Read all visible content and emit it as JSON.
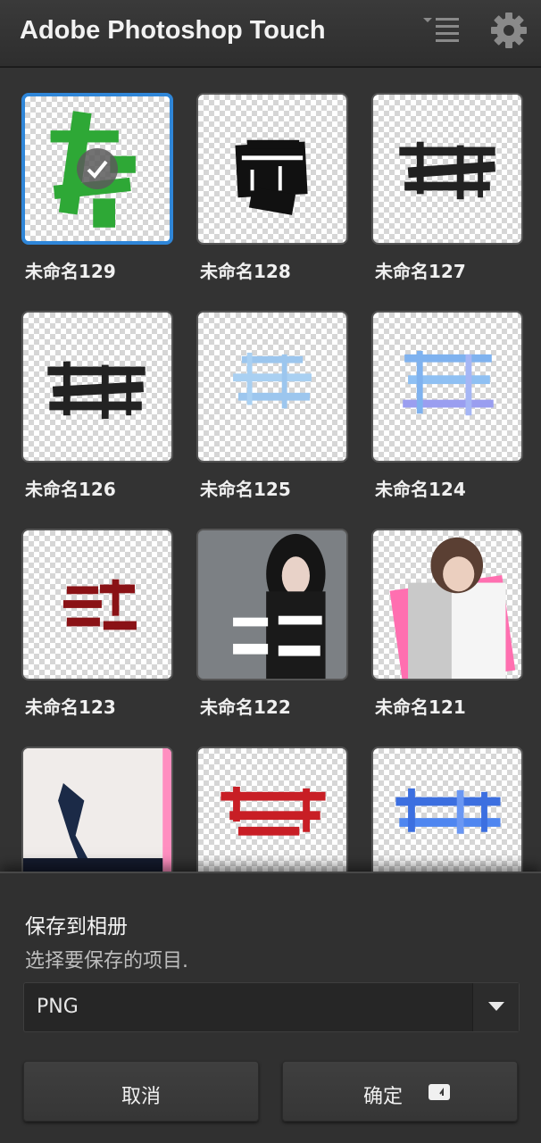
{
  "header": {
    "title": "Adobe Photoshop Touch",
    "menu_icon": "menu-list-icon",
    "settings_icon": "gear-icon"
  },
  "colors": {
    "accent": "#2f86d8",
    "background": "#333333",
    "sheet": "#303030"
  },
  "gallery": {
    "items": [
      {
        "label": "未命名129",
        "selected": true
      },
      {
        "label": "未命名128",
        "selected": false
      },
      {
        "label": "未命名127",
        "selected": false
      },
      {
        "label": "未命名126",
        "selected": false
      },
      {
        "label": "未命名125",
        "selected": false
      },
      {
        "label": "未命名124",
        "selected": false
      },
      {
        "label": "未命名123",
        "selected": false
      },
      {
        "label": "未命名122",
        "selected": false
      },
      {
        "label": "未命名121",
        "selected": false
      },
      {
        "label": "",
        "selected": false
      },
      {
        "label": "",
        "selected": false
      },
      {
        "label": "",
        "selected": false
      }
    ]
  },
  "sheet": {
    "title": "保存到相册",
    "subtitle": "选择要保存的项目.",
    "format_value": "PNG",
    "cancel_label": "取消",
    "ok_label": "确定"
  }
}
